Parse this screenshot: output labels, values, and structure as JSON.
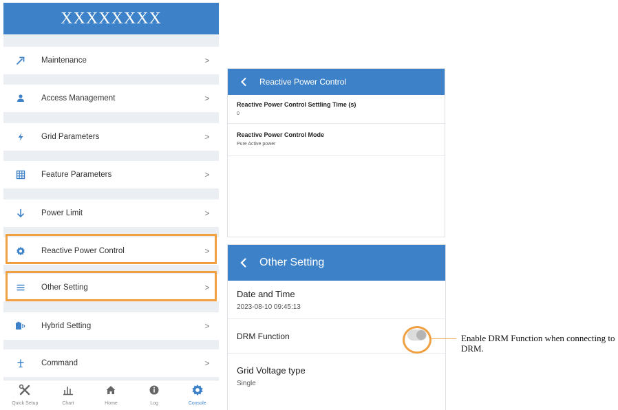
{
  "left_app": {
    "header_title": "XXXXXXXX",
    "menu": [
      {
        "label": "Maintenance",
        "icon": "wrench-icon"
      },
      {
        "label": "Access Management",
        "icon": "person-icon"
      },
      {
        "label": "Grid Parameters",
        "icon": "lightning-icon"
      },
      {
        "label": "Feature Parameters",
        "icon": "grid-icon"
      },
      {
        "label": "Power Limit",
        "icon": "arrow-down-icon"
      },
      {
        "label": "Reactive Power Control",
        "icon": "gear-icon"
      },
      {
        "label": "Other Setting",
        "icon": "hamburger-icon"
      },
      {
        "label": "Hybrid Setting",
        "icon": "battery-icon"
      },
      {
        "label": "Command",
        "icon": "command-icon"
      }
    ],
    "chevron": ">",
    "highlighted_items": [
      "Reactive Power Control",
      "Other Setting"
    ],
    "bottom_nav": [
      {
        "label": "Quick Setup",
        "icon": "tools-icon"
      },
      {
        "label": "Chart",
        "icon": "chart-icon"
      },
      {
        "label": "Home",
        "icon": "home-icon"
      },
      {
        "label": "Log",
        "icon": "info-icon"
      },
      {
        "label": "Console",
        "icon": "gear-icon",
        "active": true
      }
    ]
  },
  "reactive_panel": {
    "title": "Reactive Power Control",
    "fields": [
      {
        "label": "Reactive Power Control Settling Time (s)",
        "value": "0"
      },
      {
        "label": "Reactive Power Control Mode",
        "value": "Pure Active power"
      }
    ]
  },
  "other_panel": {
    "title": "Other Setting",
    "date_label": "Date and Time",
    "date_value": "2023-08-10 09:45:13",
    "drm_label": "DRM Function",
    "drm_enabled": false,
    "voltage_label": "Grid Voltage type",
    "voltage_value": "Single"
  },
  "annotation": {
    "text": "Enable DRM Function when connecting to DRM."
  },
  "colors": {
    "primary_blue": "#3d82c8",
    "highlight_orange": "#f0a040",
    "list_background": "#ebeef2"
  }
}
